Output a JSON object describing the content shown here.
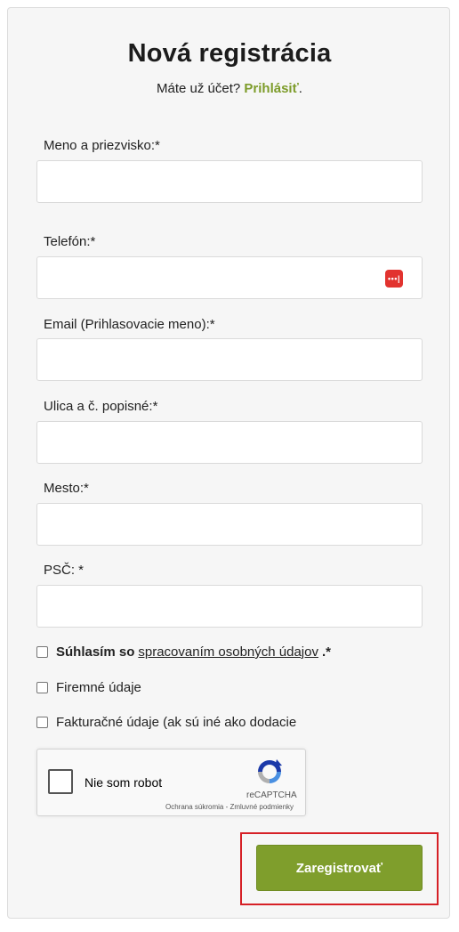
{
  "form": {
    "title": "Nová registrácia",
    "login_prompt": "Máte už účet?",
    "login_link": "Prihlásiť",
    "login_suffix": ".",
    "fields": [
      {
        "label": "Meno a priezvisko:*",
        "value": ""
      },
      {
        "label": "Telefón:*",
        "value": ""
      },
      {
        "label": "Email (Prihlasovacie meno):*",
        "value": ""
      },
      {
        "label": "Ulica a č. popisné:*",
        "value": ""
      },
      {
        "label": "Mesto:*",
        "value": ""
      },
      {
        "label": "PSČ: *",
        "value": ""
      }
    ],
    "consent": {
      "bold": "Súhlasím so",
      "link": "spracovaním osobných údajov",
      "suffix": ".*",
      "checked": false
    },
    "company_data": {
      "label": "Firemné údaje",
      "checked": false
    },
    "billing_data": {
      "label": "Fakturačné údaje (ak sú iné ako dodacie",
      "checked": false
    },
    "recaptcha": {
      "label": "Nie som robot",
      "brand": "reCAPTCHA",
      "terms": "Ochrana súkromia - Zmluvné podmienky"
    },
    "submit_label": "Zaregistrovať"
  },
  "colors": {
    "accent": "#7f9e2c",
    "link": "#7d9c2a",
    "highlight_border": "#d62026",
    "password_icon": "#e2332f"
  }
}
